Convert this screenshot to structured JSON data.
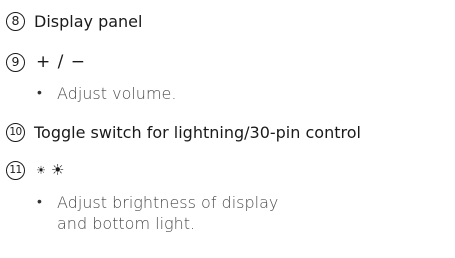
{
  "items": [
    {
      "number": "8",
      "title": "Display panel"
    },
    {
      "number": "9",
      "symbol": "+ / −",
      "bullet": "Adjust volume."
    },
    {
      "number": "10",
      "title": "Toggle switch for lightning/30-pin control"
    },
    {
      "number": "11",
      "symbol_small": "☀",
      "symbol_large": "☀",
      "bullet": "Adjust brightness of display and bottom light."
    }
  ],
  "bullet_glyph": "•"
}
